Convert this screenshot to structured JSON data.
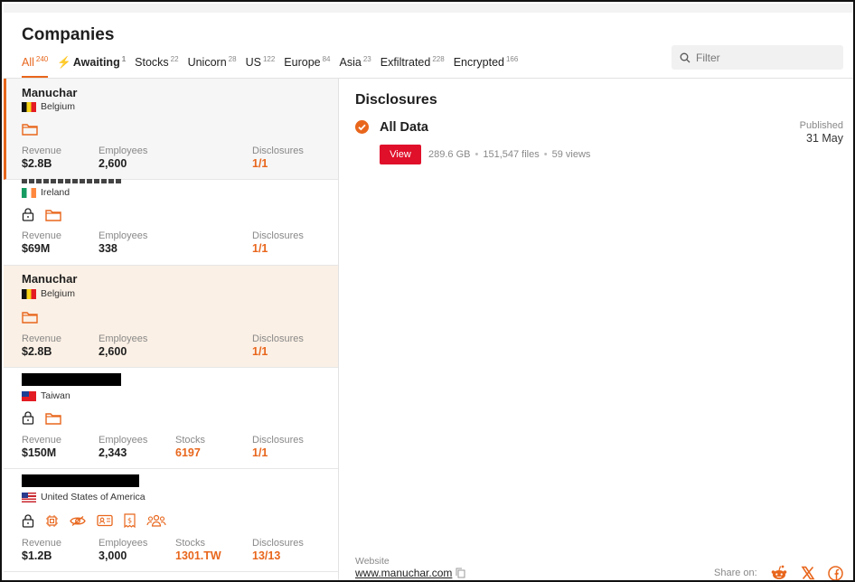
{
  "header": {
    "title": "Companies"
  },
  "tabs": [
    {
      "label": "All",
      "count": "240"
    },
    {
      "label": "Awaiting",
      "count": "1"
    },
    {
      "label": "Stocks",
      "count": "22"
    },
    {
      "label": "Unicorn",
      "count": "28"
    },
    {
      "label": "US",
      "count": "122"
    },
    {
      "label": "Europe",
      "count": "84"
    },
    {
      "label": "Asia",
      "count": "23"
    },
    {
      "label": "Exfiltrated",
      "count": "228"
    },
    {
      "label": "Encrypted",
      "count": "166"
    }
  ],
  "filter": {
    "placeholder": "Filter",
    "value": ""
  },
  "companies": [
    {
      "name": "Manuchar",
      "country": "Belgium",
      "revenue_label": "Revenue",
      "revenue": "$2.8B",
      "employees_label": "Employees",
      "employees": "2,600",
      "disclosures_label": "Disclosures",
      "disclosures": "1/1",
      "icons": [
        "folder-icon"
      ]
    },
    {
      "name": "",
      "country": "Ireland",
      "revenue_label": "Revenue",
      "revenue": "$69M",
      "employees_label": "Employees",
      "employees": "338",
      "disclosures_label": "Disclosures",
      "disclosures": "1/1",
      "icons": [
        "lock-icon",
        "folder-icon"
      ]
    },
    {
      "name": "Manuchar",
      "country": "Belgium",
      "revenue_label": "Revenue",
      "revenue": "$2.8B",
      "employees_label": "Employees",
      "employees": "2,600",
      "disclosures_label": "Disclosures",
      "disclosures": "1/1",
      "icons": [
        "folder-icon"
      ]
    },
    {
      "name": "",
      "country": "Taiwan",
      "revenue_label": "Revenue",
      "revenue": "$150M",
      "employees_label": "Employees",
      "employees": "2,343",
      "stocks_label": "Stocks",
      "stocks": "6197",
      "disclosures_label": "Disclosures",
      "disclosures": "1/1",
      "icons": [
        "lock-icon",
        "folder-icon"
      ]
    },
    {
      "name": "",
      "country": "United States of America",
      "revenue_label": "Revenue",
      "revenue": "$1.2B",
      "employees_label": "Employees",
      "employees": "3,000",
      "stocks_label": "Stocks",
      "stocks": "1301.TW",
      "disclosures_label": "Disclosures",
      "disclosures": "13/13",
      "icons": [
        "lock-icon",
        "chip-icon",
        "eye-icon",
        "id-card-icon",
        "invoice-icon",
        "people-icon"
      ]
    }
  ],
  "detail": {
    "section_title": "Disclosures",
    "item_title": "All Data",
    "published_label": "Published",
    "published_date": "31 May",
    "view_label": "View",
    "size": "289.6 GB",
    "files": "151,547 files",
    "views": "59 views",
    "website_label": "Website",
    "website": "www.manuchar.com",
    "share_label": "Share on:"
  },
  "colors": {
    "accent": "#e8661c",
    "view_button": "#e0102a"
  }
}
